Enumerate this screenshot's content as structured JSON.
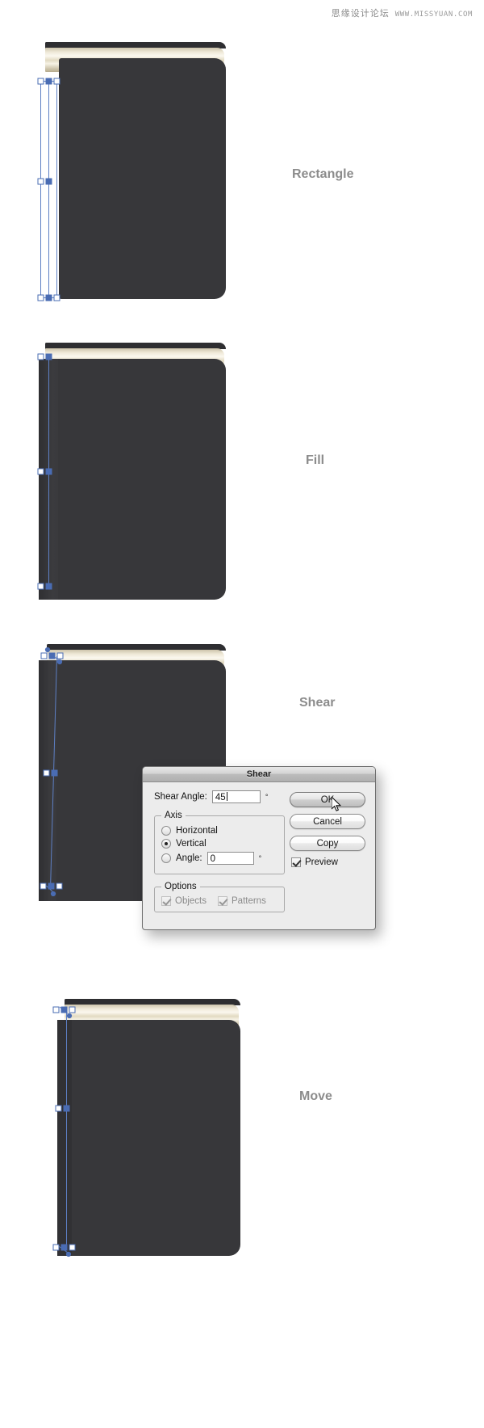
{
  "watermark": {
    "cn": "思缘设计论坛",
    "url": "WWW.MISSYUAN.COM"
  },
  "steps": [
    {
      "label": "Rectangle"
    },
    {
      "label": "Fill"
    },
    {
      "label": "Shear"
    },
    {
      "label": "Move"
    }
  ],
  "dialog": {
    "title": "Shear",
    "shear_angle": {
      "label": "Shear Angle:",
      "value": "45",
      "unit": "°"
    },
    "axis": {
      "legend": "Axis",
      "options": [
        {
          "label": "Horizontal",
          "selected": false
        },
        {
          "label": "Vertical",
          "selected": true
        },
        {
          "label": "Angle:",
          "selected": false
        }
      ],
      "angle_value": "0",
      "angle_unit": "°"
    },
    "options": {
      "legend": "Options",
      "checks": [
        {
          "label": "Objects",
          "checked": true,
          "enabled": false
        },
        {
          "label": "Patterns",
          "checked": true,
          "enabled": false
        }
      ]
    },
    "buttons": [
      {
        "label": "OK",
        "default": true
      },
      {
        "label": "Cancel",
        "default": false
      },
      {
        "label": "Copy",
        "default": false
      }
    ],
    "preview": {
      "label": "Preview",
      "checked": true
    }
  },
  "colors": {
    "cover": "#37373a",
    "cover_edge": "#2b2b2e",
    "pages_light": "#fbf8ef",
    "pages_dark": "#b6ab8d",
    "selection_blue": "#5d7fc4",
    "anchor_blue": "#4a6cb3",
    "label_gray": "#8c8c8c",
    "dialog_bg": "#ececec"
  }
}
